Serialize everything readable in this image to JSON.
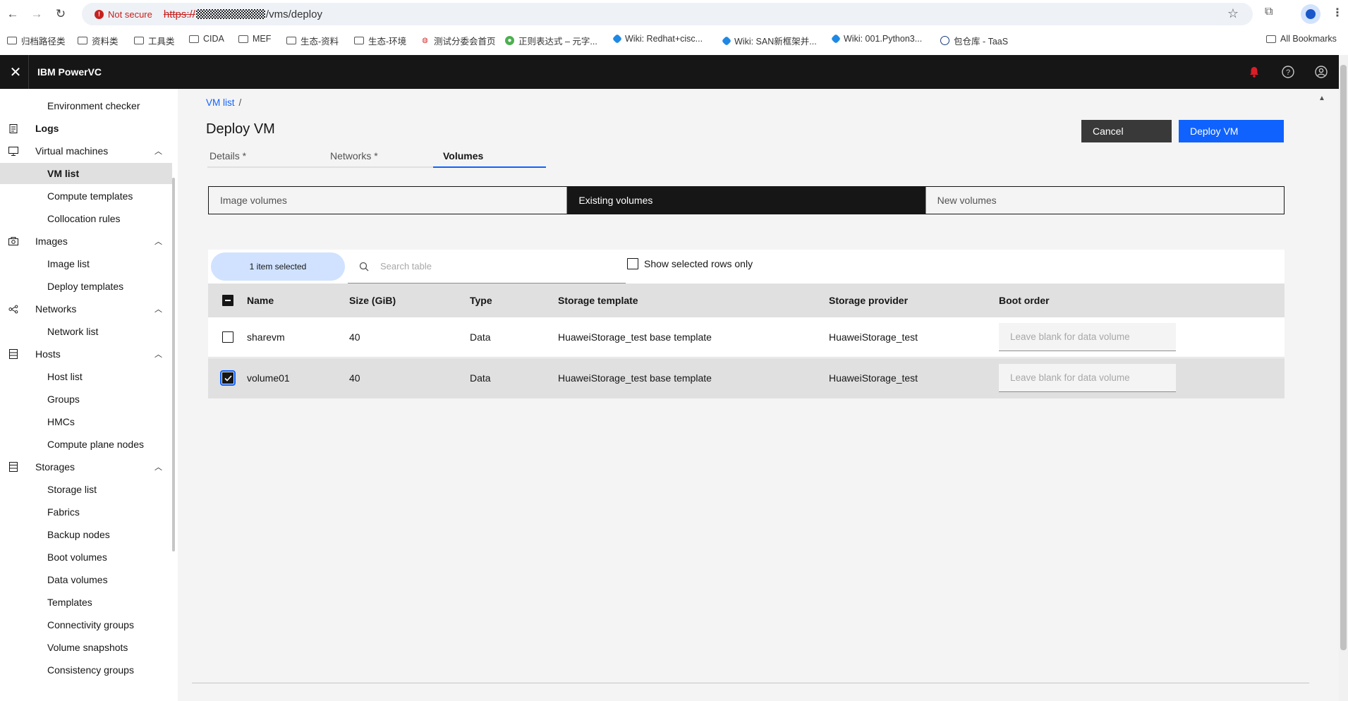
{
  "browser": {
    "not_secure": "Not secure",
    "url_scheme": "https://",
    "url_path": "/vms/deploy",
    "bookmarks": [
      "归档路径类",
      "资料类",
      "工具类",
      "CIDA",
      "MEF",
      "生态-资料",
      "生态-环境",
      "测试分委会首页",
      "正则表达式 – 元字...",
      "Wiki: Redhat+cisc...",
      "Wiki: SAN新框架并...",
      "Wiki: 001.Python3...",
      "包仓库 - TaaS"
    ],
    "all_bookmarks": "All Bookmarks"
  },
  "header": {
    "brand": "IBM PowerVC"
  },
  "sidebar": {
    "env_checker": "Environment checker",
    "logs": "Logs",
    "vm_group": "Virtual machines",
    "vm_list": "VM list",
    "compute_templates": "Compute templates",
    "collocation_rules": "Collocation rules",
    "images_group": "Images",
    "image_list": "Image list",
    "deploy_templates": "Deploy templates",
    "networks_group": "Networks",
    "network_list": "Network list",
    "hosts_group": "Hosts",
    "host_list": "Host list",
    "groups": "Groups",
    "hmcs": "HMCs",
    "compute_plane_nodes": "Compute plane nodes",
    "storages_group": "Storages",
    "storage_list": "Storage list",
    "fabrics": "Fabrics",
    "backup_nodes": "Backup nodes",
    "boot_volumes": "Boot volumes",
    "data_volumes": "Data volumes",
    "templates": "Templates",
    "connectivity_groups": "Connectivity groups",
    "volume_snapshots": "Volume snapshots",
    "consistency_groups": "Consistency groups"
  },
  "main": {
    "breadcrumb": "VM list",
    "breadcrumb_sep": "/",
    "title": "Deploy VM",
    "cancel": "Cancel",
    "deploy": "Deploy VM",
    "tabs": [
      "Details *",
      "Networks *",
      "Volumes"
    ],
    "segments": [
      "Image volumes",
      "Existing volumes",
      "New volumes"
    ],
    "selected_pill": "1 item selected",
    "search_placeholder": "Search table",
    "show_selected": "Show selected rows only",
    "columns": [
      "Name",
      "Size (GiB)",
      "Type",
      "Storage template",
      "Storage provider",
      "Boot order"
    ],
    "rows": [
      {
        "name": "sharevm",
        "size": "40",
        "type": "Data",
        "template": "HuaweiStorage_test base template",
        "provider": "HuaweiStorage_test",
        "boot_placeholder": "Leave blank for data volume",
        "checked": false
      },
      {
        "name": "volume01",
        "size": "40",
        "type": "Data",
        "template": "HuaweiStorage_test base template",
        "provider": "HuaweiStorage_test",
        "boot_placeholder": "Leave blank for data volume",
        "checked": true
      }
    ]
  },
  "colors": {
    "accent": "#0f62fe",
    "header_bg": "#161616",
    "notification": "#da1e28",
    "selected_pill": "#d0e2ff"
  }
}
